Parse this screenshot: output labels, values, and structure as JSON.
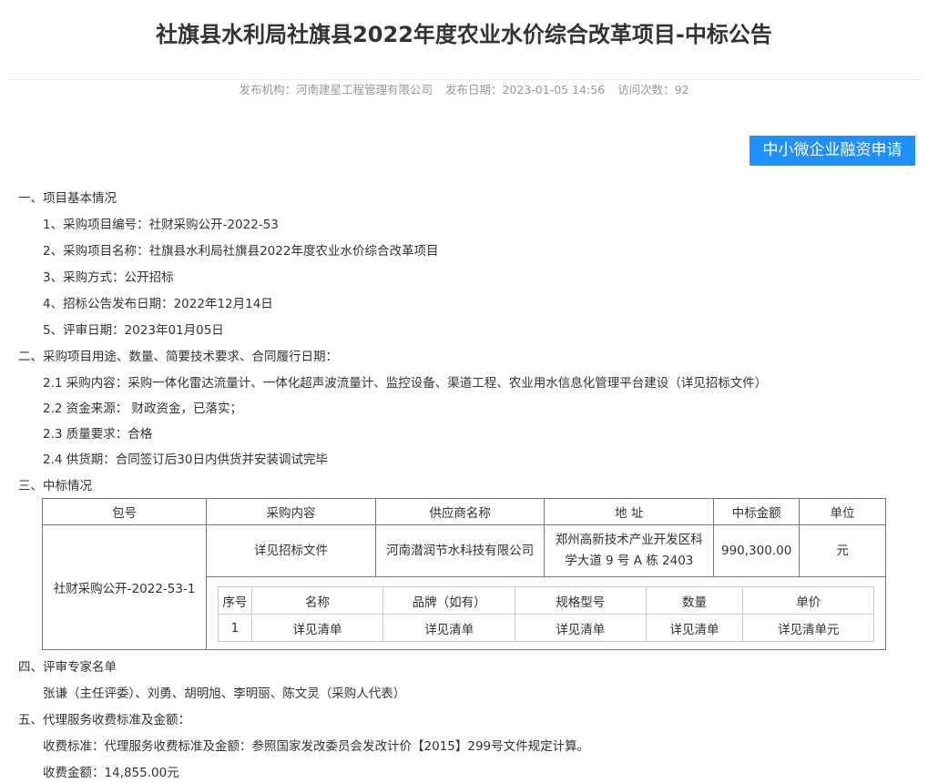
{
  "title": "社旗县水利局社旗县2022年度农业水价综合改革项目-中标公告",
  "meta": {
    "publisher": "发布机构：河南建星工程管理有限公司",
    "date": "发布日期：2023-01-05 14:56",
    "visits": "访问次数：92"
  },
  "finance_button": "中小微企业融资申请",
  "sections": {
    "s1": {
      "heading": "一、项目基本情况",
      "items": [
        "1、采购项目编号：社财采购公开-2022-53",
        "2、采购项目名称：社旗县水利局社旗县2022年度农业水价综合改革项目",
        "3、采购方式：公开招标",
        "4、招标公告发布日期：2022年12月14日",
        "5、评审日期：2023年01月05日"
      ]
    },
    "s2": {
      "heading": "二、采购项目用途、数量、简要技术要求、合同履行日期：",
      "items": [
        "2.1 采购内容：采购一体化雷达流量计、一体化超声波流量计、监控设备、渠道工程、农业用水信息化管理平台建设（详见招标文件）",
        "2.2 资金来源： 财政资金，已落实；",
        "2.3 质量要求：合格",
        "2.4 供货期：合同签订后30日内供货并安装调试完毕"
      ]
    },
    "s3": {
      "heading": "三、中标情况",
      "table": {
        "headers": [
          "包号",
          "采购内容",
          "供应商名称",
          "地 址",
          "中标金额",
          "单位"
        ],
        "row": {
          "package": "社财采购公开-2022-53-1",
          "content": "详见招标文件",
          "supplier": "河南潜润节水科技有限公司",
          "address_line1": "郑州高新技术产业开发区科",
          "address_line2": "学大道 9 号 A 栋 2403",
          "amount": "990,300.00",
          "unit": "元"
        },
        "inner": {
          "headers": [
            "序号",
            "名称",
            "品牌（如有）",
            "规格型号",
            "数量",
            "单价"
          ],
          "row": [
            "1",
            "详见清单",
            "详见清单",
            "详见清单",
            "详见清单",
            "详见清单元"
          ]
        }
      }
    },
    "s4": {
      "heading": "四、评审专家名单",
      "text": "张谦（主任评委）、刘勇、胡明旭、李明丽、陈文灵（采购人代表）"
    },
    "s5": {
      "heading": "五、代理服务收费标准及金额：",
      "standard": "收费标准：代理服务收费标准及金额：参照国家发改委员会发改计价【2015】299号文件规定计算。",
      "amount": "收费金额：14,855.00元"
    }
  }
}
